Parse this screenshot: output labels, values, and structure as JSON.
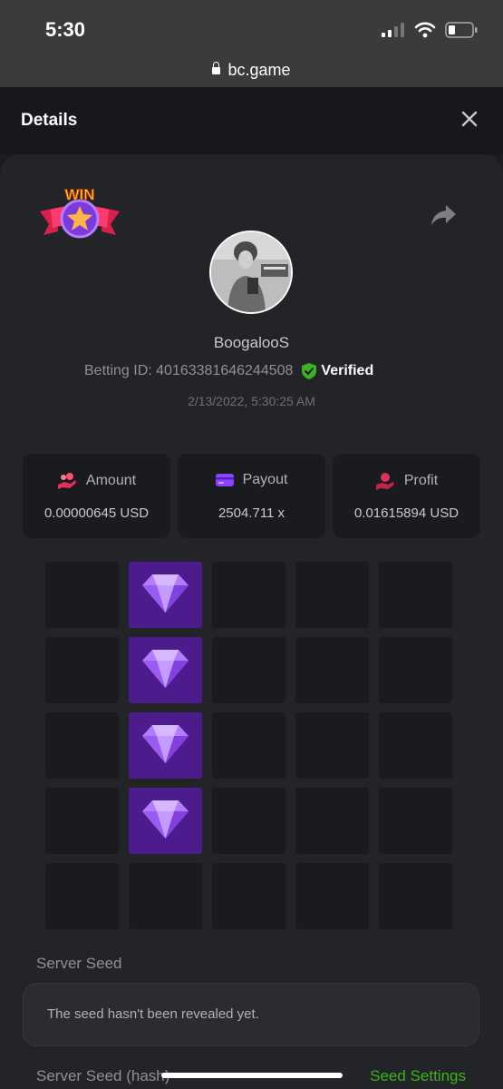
{
  "status_bar": {
    "time": "5:30"
  },
  "browser": {
    "url": "bc.game"
  },
  "header": {
    "title": "Details"
  },
  "badge": {
    "text": "WIN"
  },
  "player": {
    "username": "BoogalooS",
    "betting_id": "Betting ID: 40163381646244508",
    "verified_label": "Verified",
    "date": "2/13/2022, 5:30:25 AM"
  },
  "stats": [
    {
      "label": "Amount",
      "value": "0.00000645 USD",
      "icon": "coins-hand-icon"
    },
    {
      "label": "Payout",
      "value": "2504.711 x",
      "icon": "card-icon"
    },
    {
      "label": "Profit",
      "value": "0.01615894 USD",
      "icon": "profit-hand-icon"
    }
  ],
  "grid": {
    "rows": 5,
    "cols": 5,
    "gem_cells": [
      [
        0,
        1
      ],
      [
        1,
        1
      ],
      [
        2,
        1
      ],
      [
        3,
        1
      ]
    ],
    "gem_icon": "diamond-icon"
  },
  "server_seed": {
    "label": "Server Seed",
    "value": "The seed hasn't been revealed yet."
  },
  "server_seed_hash": {
    "label": "Server Seed (hash)"
  },
  "seed_settings_label": "Seed Settings",
  "colors": {
    "gem_tile": "#4d1c8c",
    "verified_green": "#3ab41e",
    "seed_settings": "#3ab41e"
  }
}
